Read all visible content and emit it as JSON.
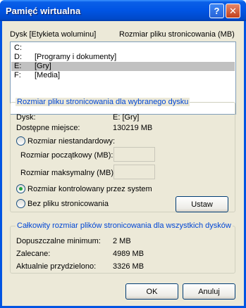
{
  "window": {
    "title": "Pamięć wirtualna",
    "help_glyph": "?",
    "close_glyph": "✕"
  },
  "drives": {
    "header_drive": "Dysk [Etykieta woluminu]",
    "header_size": "Rozmiar pliku stronicowania (MB)",
    "items": [
      {
        "drive": "C:",
        "label": ""
      },
      {
        "drive": "D:",
        "label": "[Programy i dokumenty]"
      },
      {
        "drive": "E:",
        "label": "[Gry]",
        "selected": true
      },
      {
        "drive": "F:",
        "label": "[Media]"
      }
    ]
  },
  "selected_drive": {
    "group_title": "Rozmiar pliku stronicowania dla wybranego dysku",
    "drive_label": "Dysk:",
    "drive_value": "E:  [Gry]",
    "space_label": "Dostępne miejsce:",
    "space_value": "130219  MB",
    "custom_label": "Rozmiar niestandardowy:",
    "initial_label": "Rozmiar początkowy (MB):",
    "initial_value": "",
    "max_label": "Rozmiar maksymalny (MB):",
    "max_value": "",
    "system_label": "Rozmiar kontrolowany przez system",
    "none_label": "Bez pliku stronicowania",
    "selected_option": "system",
    "set_button": "Ustaw"
  },
  "totals": {
    "group_title": "Całkowity rozmiar plików stronicowania dla wszystkich dysków",
    "min_label": "Dopuszczalne minimum:",
    "min_value": "2  MB",
    "rec_label": "Zalecane:",
    "rec_value": "4989  MB",
    "alloc_label": "Aktualnie przydzielono:",
    "alloc_value": "3326  MB"
  },
  "buttons": {
    "ok": "OK",
    "cancel": "Anuluj"
  }
}
